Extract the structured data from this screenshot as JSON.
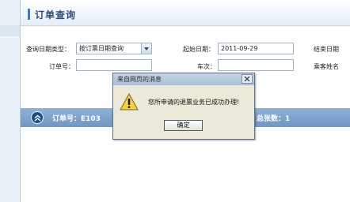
{
  "header": {
    "title": "订单查询"
  },
  "form": {
    "date_type_label": "查询日期类型：",
    "date_type_value": "按订票日期查询",
    "start_date_label": "起始日期：",
    "start_date_value": "2011-09-29",
    "end_date_label": "结束日期",
    "order_no_label": "订单号：",
    "order_no_value": "",
    "train_no_label": "车次：",
    "train_no_value": "",
    "passenger_label": "乘客姓名"
  },
  "result_bar": {
    "order_text": "订单号：E103",
    "ticket_count_text": "总张数：1"
  },
  "dialog": {
    "title": "来自网页的消息",
    "message": "您所申请的退票业务已成功办理!",
    "ok_label": "确定"
  }
}
